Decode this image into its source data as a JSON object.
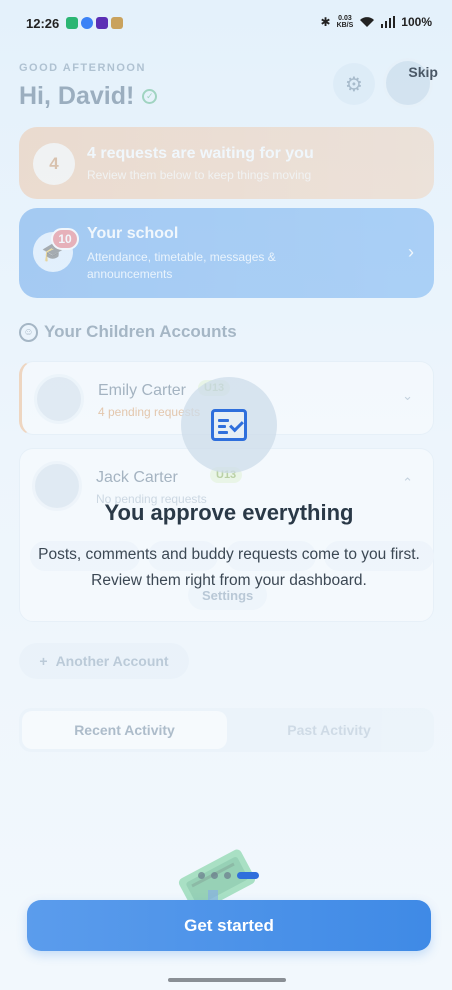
{
  "status_bar": {
    "time": "12:26",
    "speed_top": "0.03",
    "speed_unit": "KB/S",
    "battery": "100%"
  },
  "dashboard": {
    "greeting": "GOOD AFTERNOON",
    "hello": "Hi, David!",
    "requests_card": {
      "count": "4",
      "title": "4 requests are waiting for you",
      "subtitle": "Review them below to keep things moving"
    },
    "school_card": {
      "badge": "10",
      "title": "Your school",
      "subtitle": "Attendance, timetable, messages & announcements"
    },
    "children_section_title": "Your Children Accounts",
    "children": [
      {
        "name": "Emily Carter",
        "age_tag": "U13",
        "status": "4 pending requests"
      },
      {
        "name": "Jack Carter",
        "age_tag": "U13",
        "status": "No pending requests"
      }
    ],
    "jack_settings_label": "Settings",
    "add_account_label": "Another Account",
    "tabs": [
      "Recent Activity",
      "Past Activity"
    ]
  },
  "onboarding": {
    "skip_label": "Skip",
    "title": "You approve everything",
    "description": "Posts, comments and buddy requests come to you first. Review them right from your dashboard.",
    "page_indicator": {
      "current": 4,
      "total": 4
    },
    "cta_label": "Get started"
  },
  "colors": {
    "accent": "#3f8ae6",
    "requests_card": "#f0b98f",
    "school_card": "#4d9cef",
    "badge_red": "#e4515a",
    "age_tag": "#6d9a23"
  },
  "icons": [
    "gear-icon",
    "verified-check-icon",
    "graduation-cap-icon",
    "chevron-right-icon",
    "children-icon",
    "chevron-down-icon",
    "chevron-up-icon",
    "plus-icon",
    "checklist-icon",
    "basket-icon"
  ]
}
